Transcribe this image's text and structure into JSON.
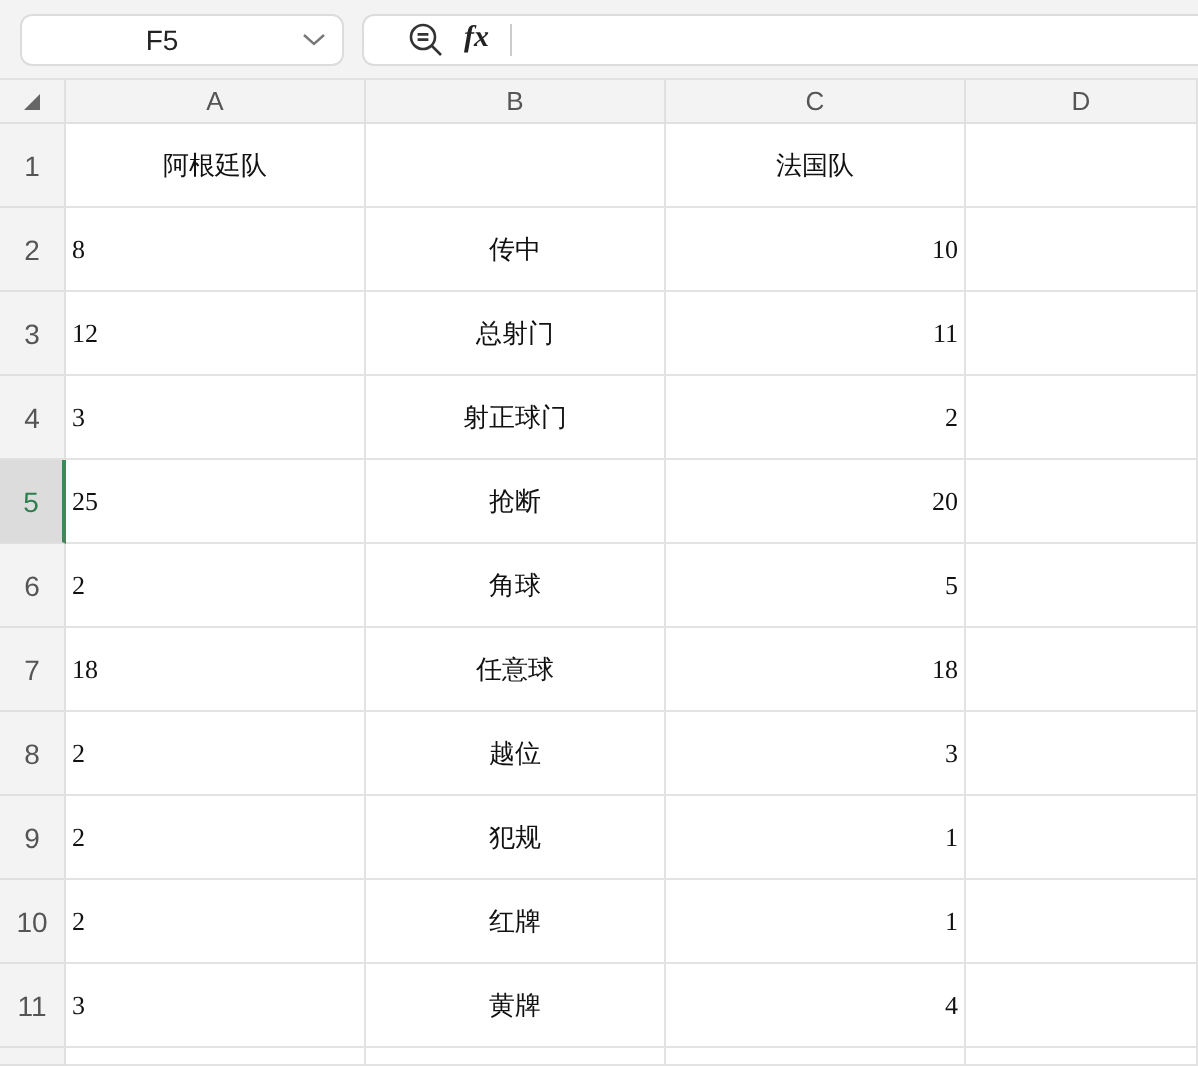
{
  "name_box": {
    "value": "F5"
  },
  "formula_bar": {
    "fx_label": "fx"
  },
  "columns": [
    {
      "label": "A",
      "selected": false
    },
    {
      "label": "B",
      "selected": false
    },
    {
      "label": "C",
      "selected": false
    },
    {
      "label": "D",
      "selected": false
    }
  ],
  "rows": [
    {
      "number": "1",
      "selected": false,
      "cells": [
        "阿根廷队",
        "",
        "法国队",
        ""
      ]
    },
    {
      "number": "2",
      "selected": false,
      "cells": [
        "8",
        "传中",
        "10",
        ""
      ]
    },
    {
      "number": "3",
      "selected": false,
      "cells": [
        "12",
        "总射门",
        "11",
        ""
      ]
    },
    {
      "number": "4",
      "selected": false,
      "cells": [
        "3",
        "射正球门",
        "2",
        ""
      ]
    },
    {
      "number": "5",
      "selected": true,
      "cells": [
        "25",
        "抢断",
        "20",
        ""
      ]
    },
    {
      "number": "6",
      "selected": false,
      "cells": [
        "2",
        "角球",
        "5",
        ""
      ]
    },
    {
      "number": "7",
      "selected": false,
      "cells": [
        "18",
        "任意球",
        "18",
        ""
      ]
    },
    {
      "number": "8",
      "selected": false,
      "cells": [
        "2",
        "越位",
        "3",
        ""
      ]
    },
    {
      "number": "9",
      "selected": false,
      "cells": [
        "2",
        "犯规",
        "1",
        ""
      ]
    },
    {
      "number": "10",
      "selected": false,
      "cells": [
        "2",
        "红牌",
        "1",
        ""
      ]
    },
    {
      "number": "11",
      "selected": false,
      "cells": [
        "3",
        "黄牌",
        "4",
        ""
      ]
    }
  ]
}
